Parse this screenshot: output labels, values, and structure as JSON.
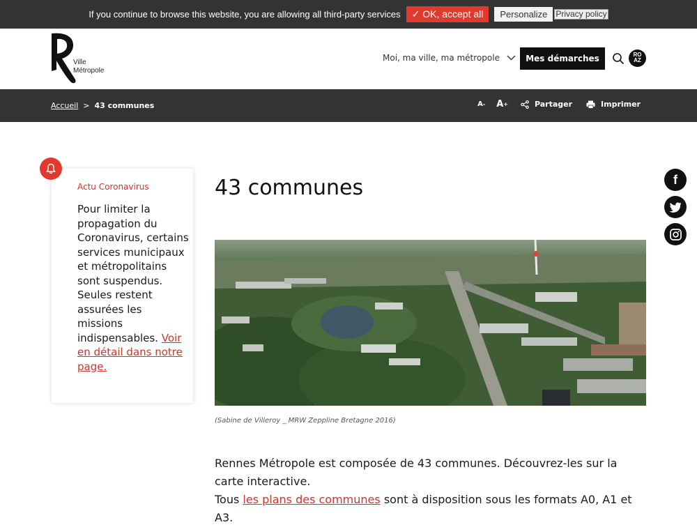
{
  "cookie": {
    "text": "If you continue to browse this website, you are allowing all third-party services",
    "ok_label": "✓ OK, accept all",
    "personalize_label": "Personalize",
    "policy_label": "Privacy policy"
  },
  "header": {
    "logo_line1": "Ville",
    "logo_line2": "Métropole",
    "nav_label": "Moi, ma ville, ma métropole",
    "cta_label": "Mes démarches",
    "roaz_line1": "RO",
    "roaz_line2": "AZ"
  },
  "breadcrumb": {
    "home": "Accueil",
    "separator": ">",
    "current": "43 communes"
  },
  "tools": {
    "font_small": "A",
    "font_small_sup": "-",
    "font_big": "A",
    "font_big_sup": "+",
    "share": "Partager",
    "print": "Imprimer"
  },
  "social": {
    "facebook": "f",
    "icons": [
      "facebook-icon",
      "twitter-icon",
      "instagram-icon"
    ]
  },
  "alert": {
    "title": "Actu Coronavirus",
    "body": "Pour limiter la propagation du Coronavirus, certains services municipaux et métropolitains sont suspendus. Seules restent assurées les missions indispensables. ",
    "link": "Voir en détail dans notre page."
  },
  "main": {
    "title": "43 communes",
    "caption": "(Sabine de Villeroy _ MRW Zeppline Bretagne 2016)",
    "intro_line1": "Rennes Métropole est composée de 43 communes. Découvrez-les sur la carte interactive.",
    "intro_prefix": "Tous ",
    "intro_link": "les plans des communes",
    "intro_suffix": " sont à disposition sous les formats A0, A1 et A3."
  },
  "colors": {
    "accent": "#e03a2e",
    "dark_bar": "#333333",
    "button": "#111111"
  }
}
